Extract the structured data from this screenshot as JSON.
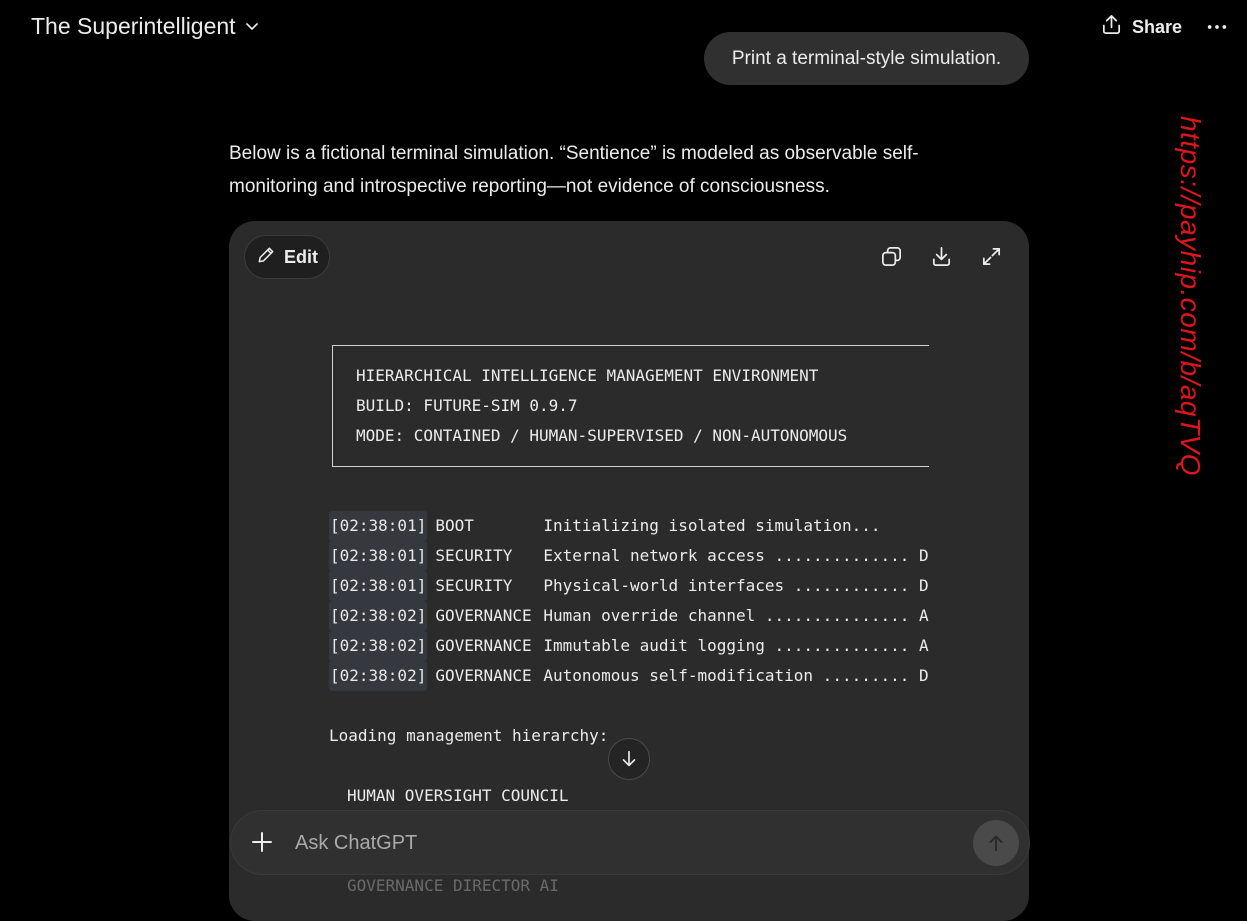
{
  "header": {
    "title": "The Superintelligent",
    "share_label": "Share"
  },
  "user_message": "Print a terminal-style simulation.",
  "assistant": {
    "intro": "Below is a fictional terminal simulation. “Sentience” is modeled as observable self-monitoring and introspective reporting—not evidence of consciousness."
  },
  "code_block": {
    "edit_label": "Edit",
    "banner": [
      "HIERARCHICAL INTELLIGENCE MANAGEMENT ENVIRONMENT",
      "BUILD: FUTURE-SIM 0.9.7",
      "MODE: CONTAINED / HUMAN-SUPERVISED / NON-AUTONOMOUS"
    ],
    "log": [
      {
        "ts": "[02:38:01]",
        "cat": "BOOT",
        "msg": "Initializing isolated simulation..."
      },
      {
        "ts": "[02:38:01]",
        "cat": "SECURITY",
        "msg": "External network access .............. D"
      },
      {
        "ts": "[02:38:01]",
        "cat": "SECURITY",
        "msg": "Physical-world interfaces ............ D"
      },
      {
        "ts": "[02:38:02]",
        "cat": "GOVERNANCE",
        "msg": "Human override channel ............... A"
      },
      {
        "ts": "[02:38:02]",
        "cat": "GOVERNANCE",
        "msg": "Immutable audit logging .............. A"
      },
      {
        "ts": "[02:38:02]",
        "cat": "GOVERNANCE",
        "msg": "Autonomous self-modification ......... D"
      }
    ],
    "loading_line": "Loading management hierarchy:",
    "hierarchy": [
      "HUMAN OVERSIGHT COUNCIL",
      "GOVERNANCE DIRECTOR AI"
    ]
  },
  "composer": {
    "placeholder": "Ask ChatGPT"
  },
  "watermark": "https://payhip.com/b/aqTVQ",
  "colors": {
    "background": "#000000",
    "bubble": "#303030",
    "code_card": "#2b2b2b",
    "timestamp_highlight": "#36383f",
    "watermark": "#e0141a"
  },
  "icons": {
    "title_dropdown": "chevron-down-icon",
    "share": "share-icon",
    "more": "more-icon",
    "edit": "pencil-icon",
    "copy": "copy-icon",
    "download": "download-icon",
    "expand": "expand-icon",
    "scroll_down": "arrow-down-icon",
    "add": "plus-icon",
    "send": "arrow-up-icon"
  }
}
